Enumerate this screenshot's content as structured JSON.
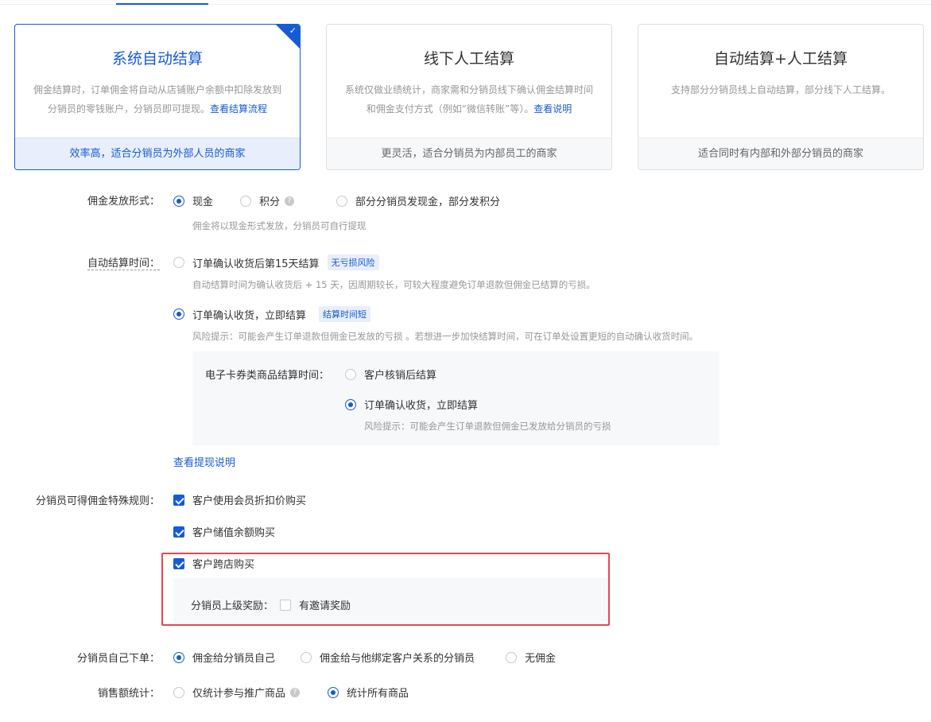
{
  "cards": [
    {
      "title": "系统自动结算",
      "desc1": "佣金结算时，订单佣金将自动从店铺账户余额中扣除发放到",
      "desc2": "分销员的零钱账户，分销员即可提现。",
      "link": "查看结算流程",
      "footer": "效率高，适合分销员为外部人员的商家"
    },
    {
      "title": "线下人工结算",
      "desc1": "系统仅做业绩统计，商家需和分销员线下确认佣金结算时间",
      "desc2": "和佣金支付方式（例如“微信转账”等）。",
      "link": "查看说明",
      "footer": "更灵活，适合分销员为内部员工的商家"
    },
    {
      "title": "自动结算+人工结算",
      "desc1": "支持部分分销员线上自动结算，部分线下人工结算。",
      "footer": "适合同时有内部和外部分销员的商家"
    }
  ],
  "payout": {
    "label": "佣金发放形式：",
    "options": [
      "现金",
      "积分",
      "部分分销员发现金，部分发积分"
    ],
    "help": "?",
    "hint": "佣金将以现金形式发放，分销员可自行提现"
  },
  "auto_time": {
    "label": "自动结算时间：",
    "opt1": "订单确认收货后第15天结算",
    "tag1": "无亏损风险",
    "hint1": "自动结算时间为确认收货后 + 15 天，因周期较长，可较大程度避免订单退款但佣金已结算的亏损。",
    "opt2": "订单确认收货，立即结算",
    "tag2": "结算时间短",
    "hint2": "风险提示：可能会产生订单退款但佣金已发放的亏损 。若想进一步加快结算时间，可在订单处设置更短的自动确认收货时间。"
  },
  "ecard": {
    "label": "电子卡券类商品结算时间：",
    "opt1": "客户核销后结算",
    "opt2": "订单确认收货，立即结算",
    "hint": "风险提示：可能会产生订单退款但佣金已发放给分销员的亏损"
  },
  "withdraw_link": "查看提现说明",
  "special": {
    "label": "分销员可得佣金特殊规则：",
    "items": [
      "客户使用会员折扣价购买",
      "客户储值余额购买",
      "客户跨店购买"
    ],
    "superior_label": "分销员上级奖励：",
    "superior_option": "有邀请奖励"
  },
  "self_order": {
    "label": "分销员自己下单：",
    "options": [
      "佣金给分销员自己",
      "佣金给与他绑定客户关系的分销员",
      "无佣金"
    ]
  },
  "sales": {
    "label": "销售额统计：",
    "options": [
      "仅统计参与推广商品",
      "统计所有商品"
    ],
    "help": "?"
  },
  "colors": {
    "primary": "#155bd4",
    "highlight_border": "#e8474d"
  }
}
